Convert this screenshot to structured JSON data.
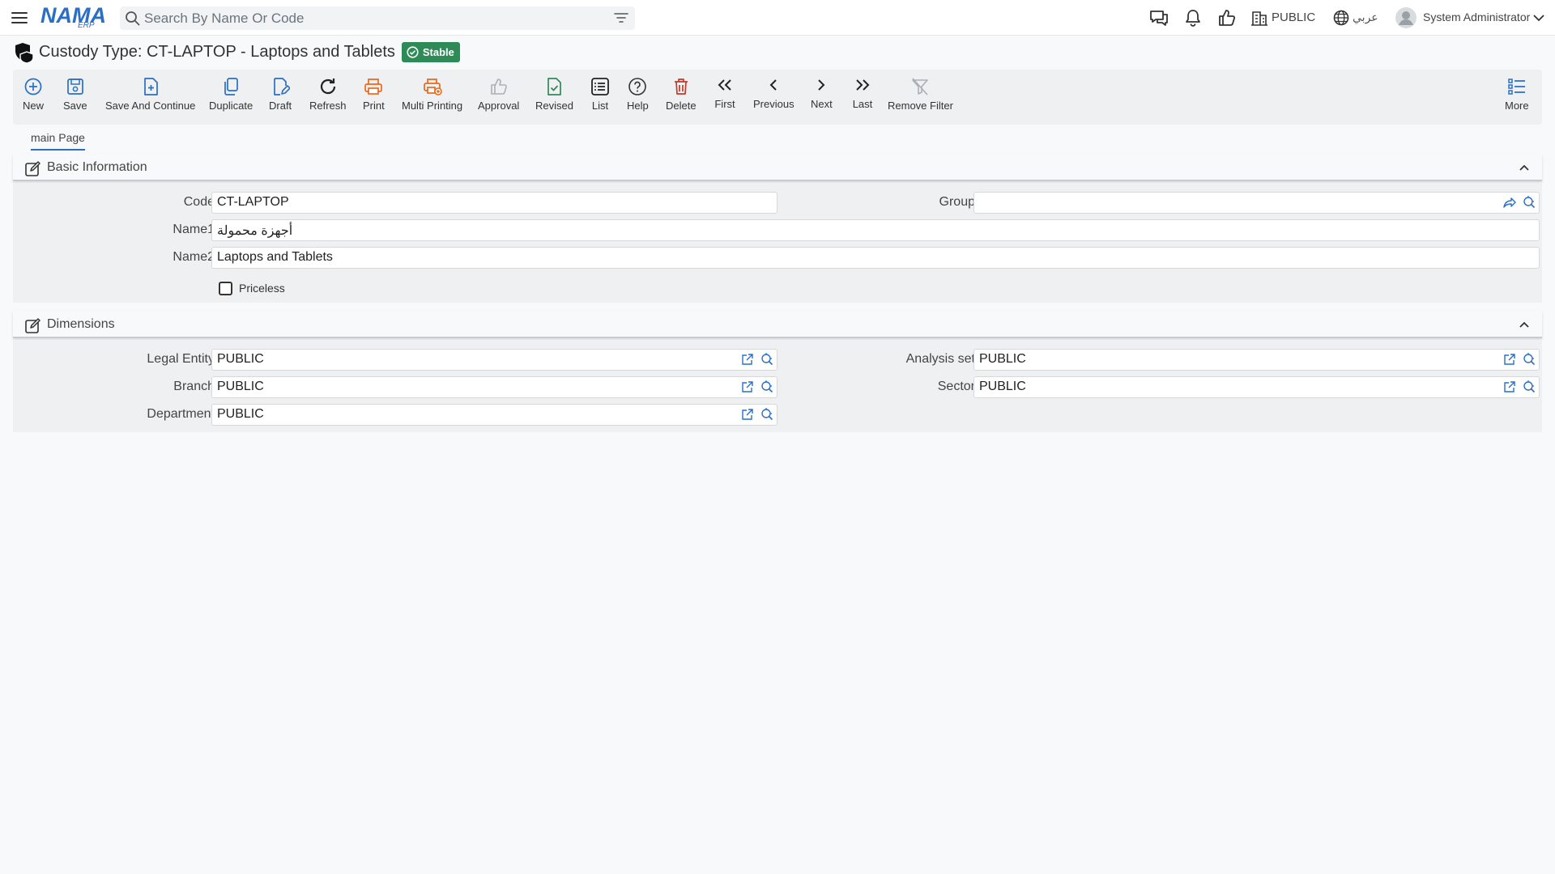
{
  "app": {
    "logo_main": "NAMA",
    "logo_sub": "ERP",
    "search_placeholder": "Search By Name Or Code",
    "company": "PUBLIC",
    "language": "عربي",
    "user": "System Administrator"
  },
  "page": {
    "title": "Custody Type: CT-LAPTOP - Laptops and Tablets",
    "status": "Stable"
  },
  "toolbar": [
    {
      "label": "New",
      "icon": "plus-circle-icon"
    },
    {
      "label": "Save",
      "icon": "save-icon"
    },
    {
      "label": "Save And Continue",
      "icon": "save-continue-icon"
    },
    {
      "label": "Duplicate",
      "icon": "duplicate-icon"
    },
    {
      "label": "Draft",
      "icon": "draft-icon"
    },
    {
      "label": "Refresh",
      "icon": "refresh-icon"
    },
    {
      "label": "Print",
      "icon": "print-icon"
    },
    {
      "label": "Multi Printing",
      "icon": "multi-print-icon"
    },
    {
      "label": "Approval",
      "icon": "thumbs-up-icon"
    },
    {
      "label": "Revised",
      "icon": "revised-icon"
    },
    {
      "label": "List",
      "icon": "list-icon"
    },
    {
      "label": "Help",
      "icon": "help-icon"
    },
    {
      "label": "Delete",
      "icon": "trash-icon"
    },
    {
      "label": "First",
      "icon": "double-chevron-left-icon"
    },
    {
      "label": "Previous",
      "icon": "chevron-left-icon"
    },
    {
      "label": "Next",
      "icon": "chevron-right-icon"
    },
    {
      "label": "Last",
      "icon": "double-chevron-right-icon"
    },
    {
      "label": "Remove Filter",
      "icon": "filter-off-icon"
    },
    {
      "label": "More",
      "icon": "more-list-icon"
    }
  ],
  "tabs": [
    {
      "label": "main Page"
    }
  ],
  "basic": {
    "title": "Basic Information",
    "code_label": "Code",
    "code_value": "CT-LAPTOP",
    "group_label": "Group",
    "group_value": "",
    "name1_label": "Name1",
    "name1_value": "أجهزة محمولة",
    "name2_label": "Name2",
    "name2_value": "Laptops and Tablets",
    "priceless_label": "Priceless"
  },
  "dimensions": {
    "title": "Dimensions",
    "legal_entity_label": "Legal Entity",
    "legal_entity_value": "PUBLIC",
    "analysis_set_label": "Analysis set",
    "analysis_set_value": "PUBLIC",
    "branch_label": "Branch",
    "branch_value": "PUBLIC",
    "sector_label": "Sector",
    "sector_value": "PUBLIC",
    "department_label": "Department",
    "department_value": "PUBLIC"
  },
  "colors": {
    "accent": "#2a6fc4",
    "status_green": "#2e8b57",
    "print_orange": "#e8691e",
    "delete_red": "#c0392b"
  }
}
